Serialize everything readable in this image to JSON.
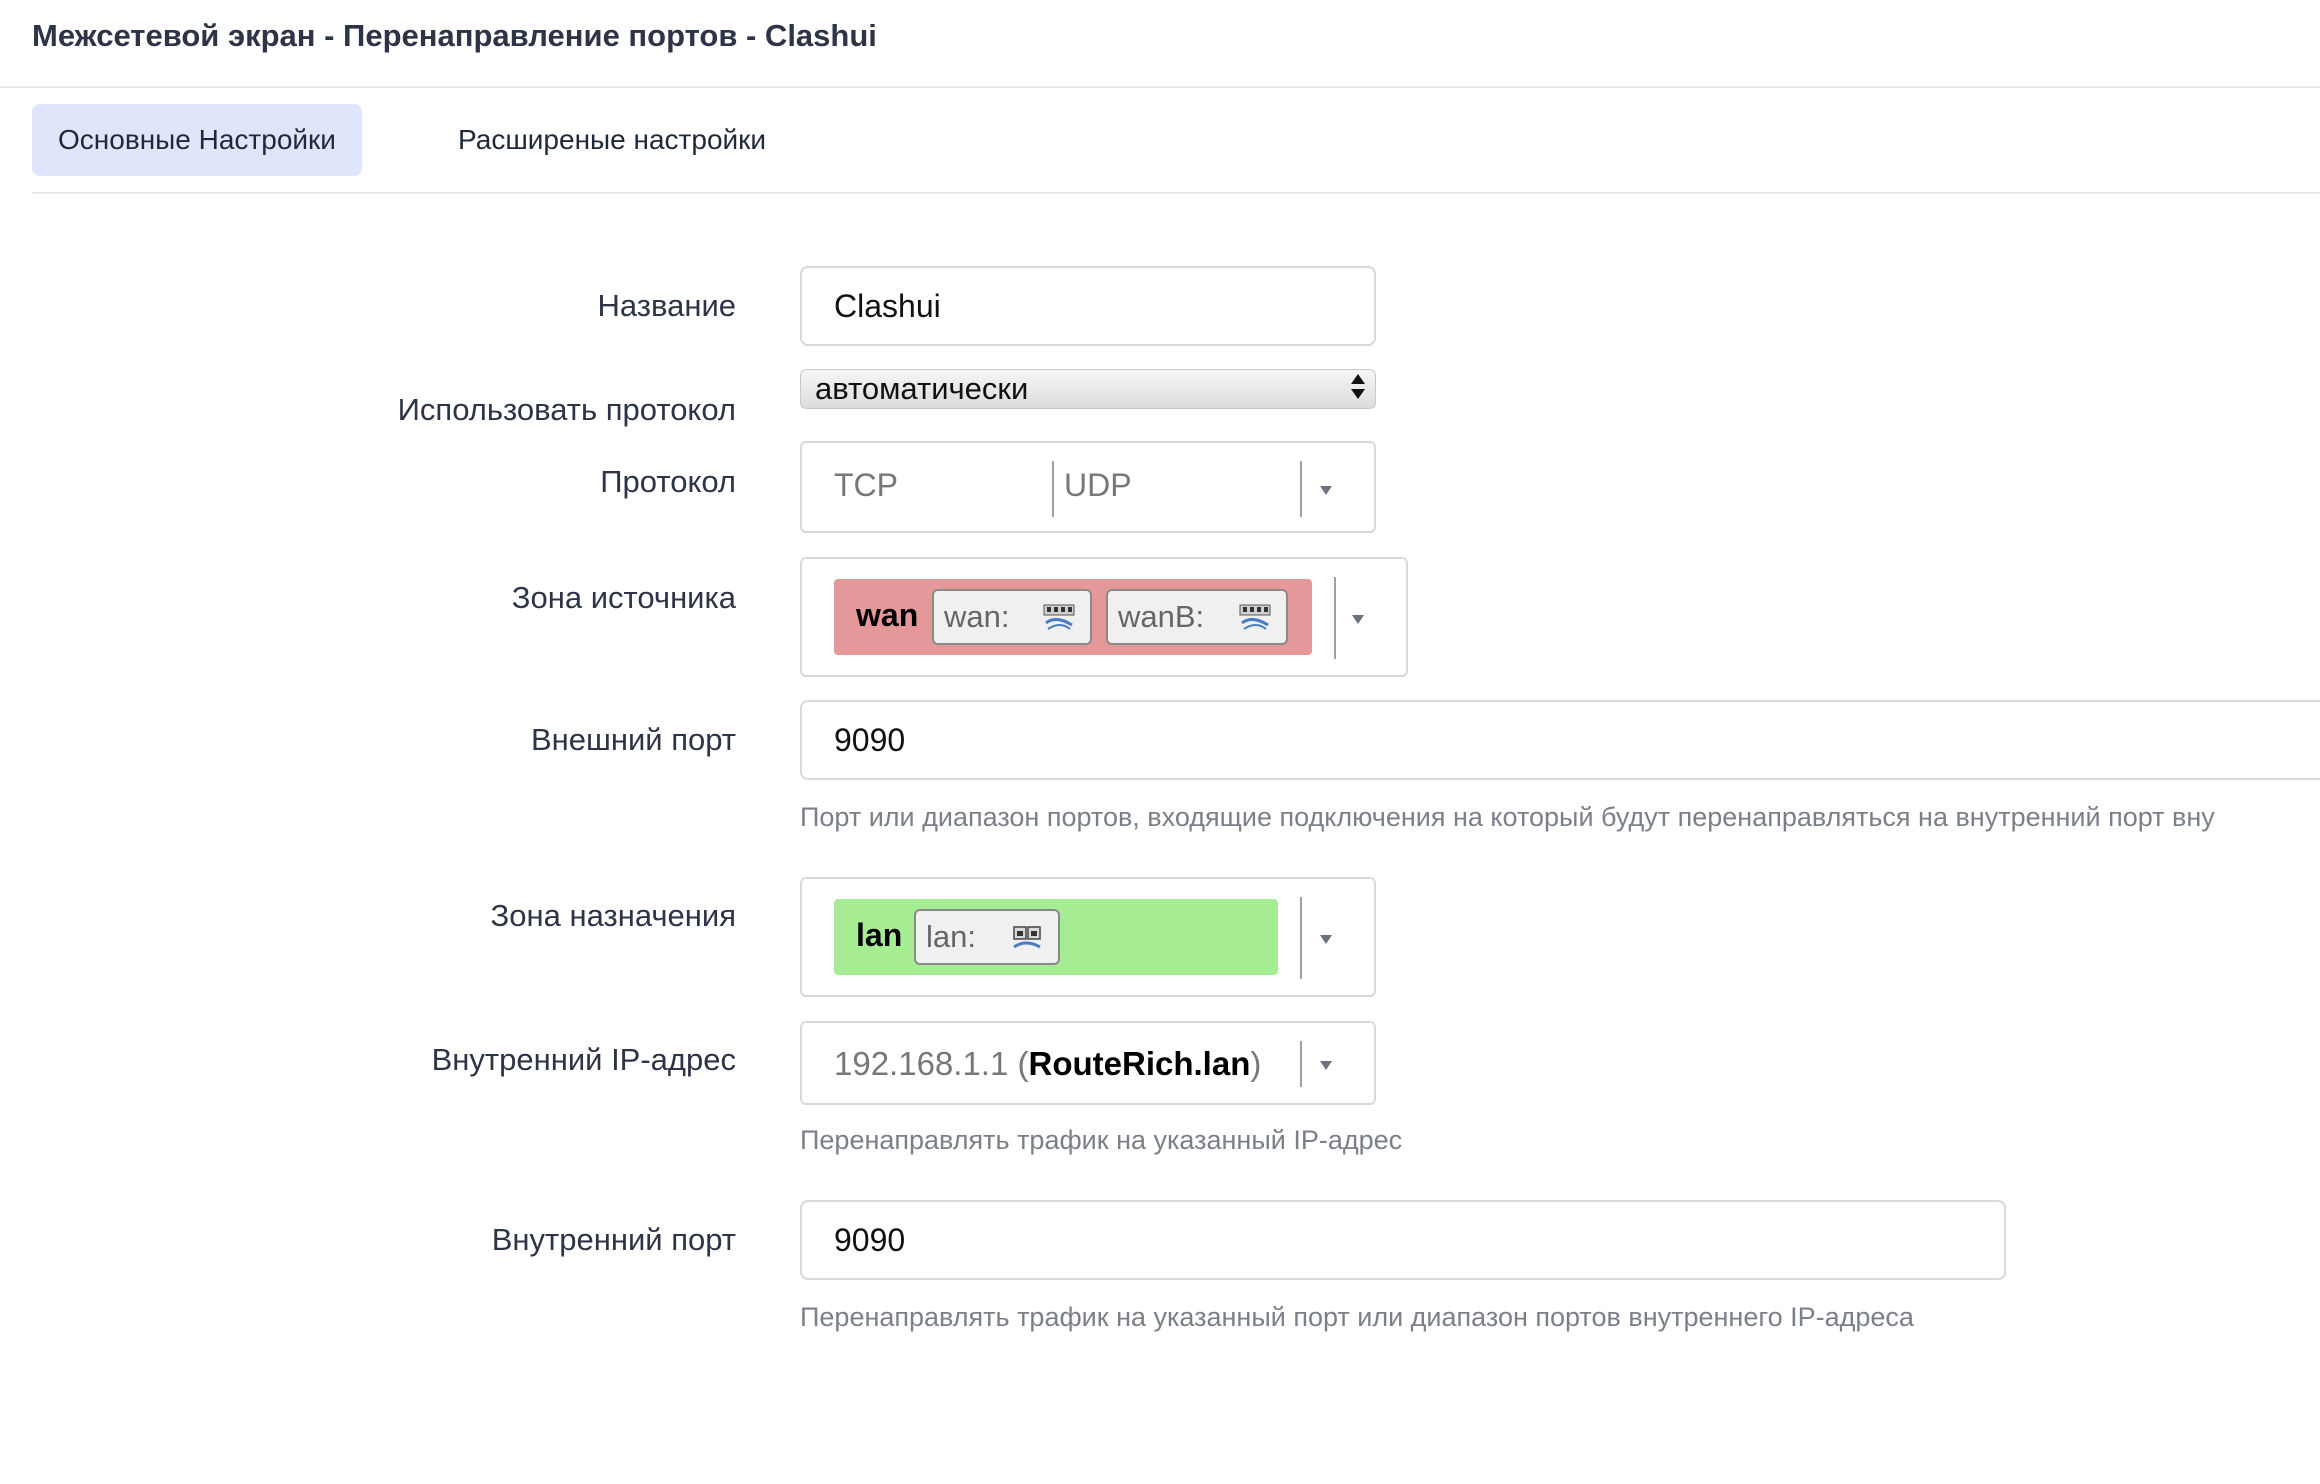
{
  "header": {
    "title": "Межсетевой экран - Перенаправление портов - Clashui"
  },
  "tabs": [
    {
      "label": "Основные Настройки",
      "active": true
    },
    {
      "label": "Расширеные настройки",
      "active": false
    }
  ],
  "form": {
    "name": {
      "label": "Название",
      "value": "Clashui"
    },
    "protocol_family": {
      "label": "Использовать протокол",
      "value": "автоматически"
    },
    "protocol": {
      "label": "Протокол",
      "values": [
        "TCP",
        "UDP"
      ]
    },
    "src_zone": {
      "label": "Зона источника",
      "zone": "wan",
      "color": "#e59899",
      "interfaces": [
        "wan:",
        "wanB:"
      ]
    },
    "ext_port": {
      "label": "Внешний порт",
      "value": "9090",
      "help": "Порт или диапазон портов, входящие подключения на который будут перенаправляться на внутренний порт вну"
    },
    "dest_zone": {
      "label": "Зона назначения",
      "zone": "lan",
      "color": "#a6ec93",
      "interfaces": [
        "lan:"
      ]
    },
    "internal_ip": {
      "label": "Внутренний IP-адрес",
      "ip": "192.168.1.1",
      "host": "RouteRich.lan",
      "help": "Перенаправлять трафик на указанный IP-адрес"
    },
    "internal_port": {
      "label": "Внутренний порт",
      "value": "9090",
      "help": "Перенаправлять трафик на указанный порт или диапазон портов внутреннего IP-адреса"
    }
  }
}
